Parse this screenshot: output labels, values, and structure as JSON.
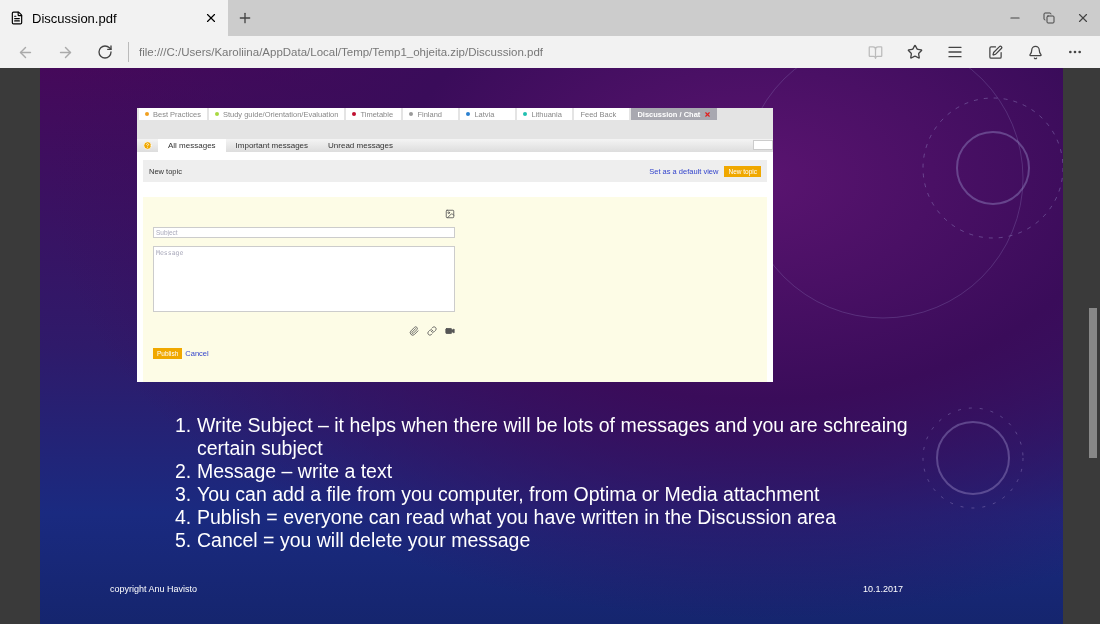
{
  "browser": {
    "tab": {
      "title": "Discussion.pdf"
    },
    "address": "file:///C:/Users/Karoliina/AppData/Local/Temp/Temp1_ohjeita.zip/Discussion.pdf"
  },
  "slide": {
    "screenshot": {
      "course_tabs": [
        {
          "label": "Best Practices",
          "color": "#f0a020",
          "selected": false
        },
        {
          "label": "Study guide/Orientation/Evaluation",
          "color": "#a8d840",
          "selected": false
        },
        {
          "label": "Timetable",
          "color": "#c01030",
          "selected": false
        },
        {
          "label": "Finland",
          "color": "#9a9a9a",
          "selected": false
        },
        {
          "label": "Latvia",
          "color": "#2a80d0",
          "selected": false
        },
        {
          "label": "Lithuania",
          "color": "#20c0b0",
          "selected": false
        },
        {
          "label": "Feed Back",
          "selected": false
        },
        {
          "label": "Discussion / Chat",
          "selected": true
        }
      ],
      "message_tabs": [
        {
          "label": "All messages",
          "selected": true
        },
        {
          "label": "Important messages",
          "selected": false
        },
        {
          "label": "Unread messages",
          "selected": false
        }
      ],
      "new_topic_title": "New topic",
      "default_view_link": "Set as a default view",
      "new_topic_button": "New topic",
      "subject": {
        "placeholder": "Subject"
      },
      "message": {
        "placeholder": "Message"
      },
      "publish_button": "Publish",
      "cancel_link": "Cancel"
    },
    "steps": [
      {
        "number": "1.",
        "text": "Write Subject – it helps when there will be lots of messages and you are schreaing certain subject"
      },
      {
        "number": "2.",
        "text": "Message – write a text"
      },
      {
        "number": "3.",
        "text": "You can add a file from you computer, from Optima or Media attachment"
      },
      {
        "number": "4.",
        "text": "Publish = everyone can read what you have written in the Discussion area"
      },
      {
        "number": "5.",
        "text": "Cancel = you will delete your message"
      }
    ],
    "copyright": "copyright Anu Havisto",
    "date": "10.1.2017"
  }
}
